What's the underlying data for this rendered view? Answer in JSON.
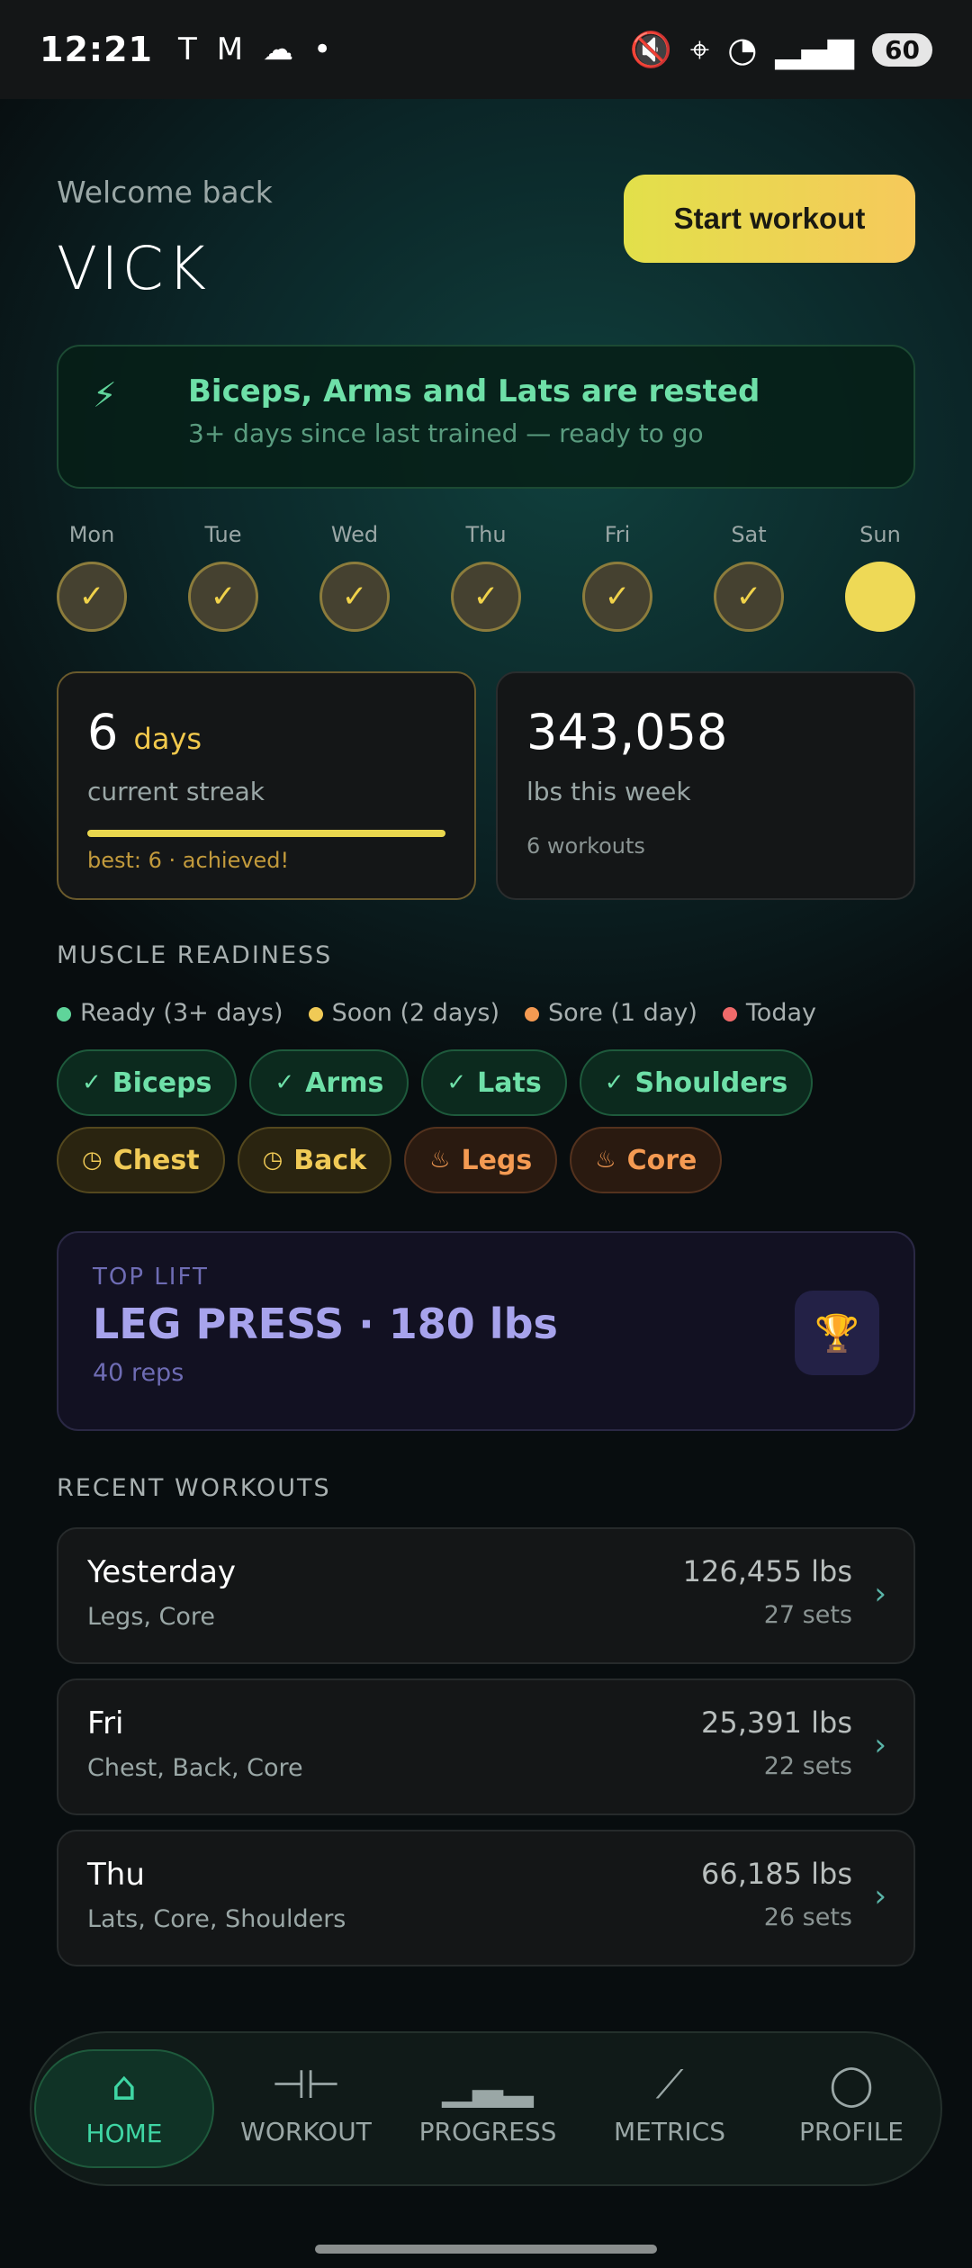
{
  "status": {
    "time": "12:21",
    "battery": "60"
  },
  "header": {
    "welcome": "Welcome back",
    "username": "VICK",
    "start_label": "Start workout"
  },
  "rested": {
    "title": "Biceps, Arms and Lats are rested",
    "subtitle": "3+ days since last trained — ready to go"
  },
  "week": [
    {
      "label": "Mon",
      "done": true
    },
    {
      "label": "Tue",
      "done": true
    },
    {
      "label": "Wed",
      "done": true
    },
    {
      "label": "Thu",
      "done": true
    },
    {
      "label": "Fri",
      "done": true
    },
    {
      "label": "Sat",
      "done": true
    },
    {
      "label": "Sun",
      "done": false
    }
  ],
  "streak": {
    "value": "6",
    "unit": "days",
    "label": "current streak",
    "progress": 1.0,
    "best": "best: 6 · achieved!"
  },
  "volume": {
    "value": "343,058",
    "label": "lbs this week",
    "workouts": "6 workouts"
  },
  "readiness": {
    "title": "MUSCLE READINESS",
    "legend": [
      {
        "label": "Ready (3+ days)",
        "color": "#5fd49a"
      },
      {
        "label": "Soon (2 days)",
        "color": "#f0ca56"
      },
      {
        "label": "Sore (1 day)",
        "color": "#f49a52"
      },
      {
        "label": "Today",
        "color": "#f06a6a"
      }
    ],
    "row1": [
      {
        "label": "Biceps",
        "state": "ready",
        "icon": "check-circle-icon"
      },
      {
        "label": "Arms",
        "state": "ready",
        "icon": "check-circle-icon"
      },
      {
        "label": "Lats",
        "state": "ready",
        "icon": "check-circle-icon"
      },
      {
        "label": "Shoulders",
        "state": "ready",
        "icon": "check-circle-icon"
      }
    ],
    "row2": [
      {
        "label": "Chest",
        "state": "soon",
        "icon": "clock-icon"
      },
      {
        "label": "Back",
        "state": "soon",
        "icon": "clock-icon"
      },
      {
        "label": "Legs",
        "state": "sore",
        "icon": "flame-icon"
      },
      {
        "label": "Core",
        "state": "sore",
        "icon": "flame-icon"
      }
    ]
  },
  "top_lift": {
    "label": "TOP LIFT",
    "value": "LEG PRESS · 180 lbs",
    "reps": "40 reps",
    "icon": "trophy-icon"
  },
  "recent": {
    "title": "RECENT WORKOUTS",
    "items": [
      {
        "day": "Yesterday",
        "muscles": "Legs, Core",
        "lbs": "126,455 lbs",
        "sets": "27 sets"
      },
      {
        "day": "Fri",
        "muscles": "Chest, Back, Core",
        "lbs": "25,391 lbs",
        "sets": "22 sets"
      },
      {
        "day": "Thu",
        "muscles": "Lats, Core, Shoulders",
        "lbs": "66,185 lbs",
        "sets": "26 sets"
      }
    ]
  },
  "nav": [
    {
      "label": "HOME",
      "icon": "home-icon",
      "active": true
    },
    {
      "label": "WORKOUT",
      "icon": "dumbbell-icon",
      "active": false
    },
    {
      "label": "PROGRESS",
      "icon": "bar-chart-icon",
      "active": false
    },
    {
      "label": "METRICS",
      "icon": "trend-line-icon",
      "active": false
    },
    {
      "label": "PROFILE",
      "icon": "person-icon",
      "active": false
    }
  ]
}
